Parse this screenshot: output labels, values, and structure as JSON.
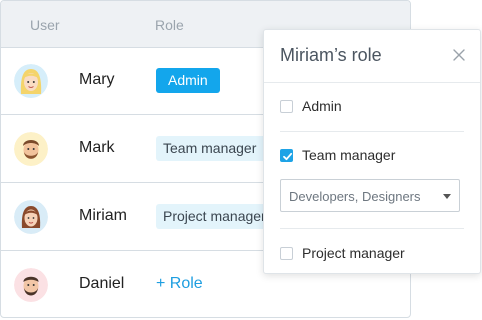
{
  "table": {
    "header_user": "User",
    "header_role": "Role",
    "rows": [
      {
        "name": "Mary",
        "role": "Admin"
      },
      {
        "name": "Mark",
        "role": "Team manager"
      },
      {
        "name": "Miriam",
        "role": "Project manager"
      },
      {
        "name": "Daniel",
        "add_role": "+ Role"
      }
    ]
  },
  "popover": {
    "title": "Miriam’s role",
    "options": [
      {
        "label": "Admin",
        "checked": false
      },
      {
        "label": "Team manager",
        "checked": true
      },
      {
        "label": "Project manager",
        "checked": false
      }
    ],
    "select": {
      "value": "Developers, Designers"
    }
  },
  "colors": {
    "accent": "#13a6ec",
    "tag_background": "#e3f4fb",
    "link": "#1e9ee0",
    "header_background": "#eef1f4"
  },
  "icons": {
    "close": "close-icon",
    "check": "checkmark-icon",
    "dropdown": "chevron-down-icon"
  }
}
